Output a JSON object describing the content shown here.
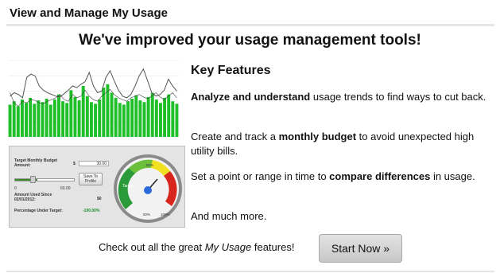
{
  "header": {
    "title": "View and Manage My Usage"
  },
  "promo": {
    "headline": "We've improved your usage management tools!",
    "features_title": "Key Features",
    "feature1": {
      "bold": "Analyze and understand",
      "rest": " usage trends to find ways to cut back."
    },
    "feature2": {
      "pre": "Create and track a ",
      "bold": "monthly budget",
      "post": " to avoid unexpected high utility bills."
    },
    "feature3": {
      "pre": "Set a point or range in time to ",
      "bold": "compare differences",
      "post": " in usage."
    },
    "feature4": "And much more.",
    "cta_pre": "Check out all the great ",
    "cta_italic": "My Usage",
    "cta_post": " features!",
    "start_button": "Start Now »"
  },
  "usage_chart": {
    "bars": [
      38,
      42,
      36,
      44,
      40,
      46,
      39,
      43,
      41,
      45,
      38,
      44,
      50,
      42,
      40,
      55,
      47,
      43,
      60,
      48,
      41,
      39,
      44,
      58,
      62,
      52,
      46,
      40,
      38,
      42,
      45,
      49,
      43,
      41,
      47,
      52,
      44,
      40,
      46,
      50,
      42,
      39
    ],
    "line1": [
      48,
      52,
      50,
      46,
      70,
      74,
      72,
      60,
      55,
      52,
      50,
      48,
      47,
      51,
      55,
      60,
      58,
      62,
      65,
      76,
      60,
      52,
      54,
      70,
      78,
      66,
      55,
      48,
      46,
      50,
      60,
      72,
      80,
      66,
      52,
      48,
      50,
      55,
      68,
      60,
      54
    ],
    "line2": [
      52,
      40,
      36,
      42,
      40,
      44,
      43,
      40,
      39,
      42,
      44,
      46,
      50,
      44,
      42,
      50,
      46,
      48,
      55,
      48,
      44,
      42,
      48,
      52,
      56,
      50,
      46,
      44,
      42,
      46,
      48,
      50,
      47,
      45,
      48,
      52,
      47,
      44,
      48,
      52,
      46
    ]
  },
  "budget_widget": {
    "target_label": "Target Monthly Budget Amount:",
    "dollar": "$",
    "target_value": "30.00",
    "slider_min": "0",
    "slider_max": "60.00",
    "slider_fraction": 0.38,
    "save_button": "Save To Profile",
    "amount_used_label": "Amount Used Since 02/01/2012:",
    "amount_used_value": "$0",
    "percent_under_label": "Percentage Under Target:",
    "percent_under_value": "-100.00%",
    "gauge": {
      "target_label": "Target",
      "pct_low": "50%",
      "pct_high": "100%",
      "pct_mid": "80%"
    }
  }
}
